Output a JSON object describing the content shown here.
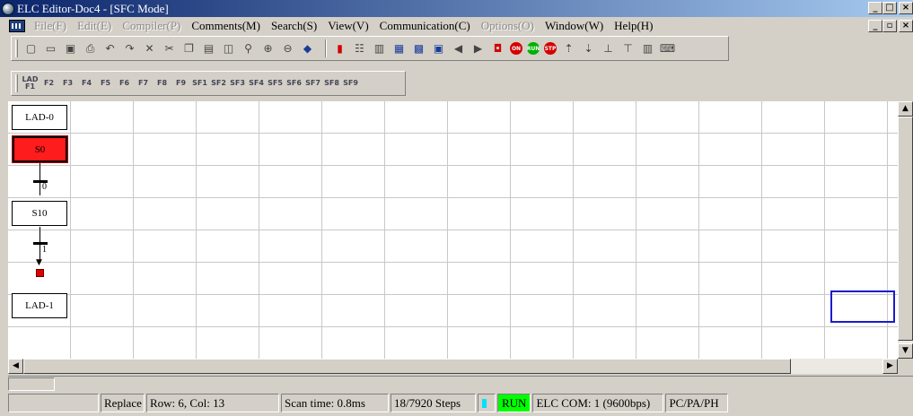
{
  "window": {
    "title": "ELC Editor-Doc4 - [SFC Mode]",
    "controls": {
      "minimize": "_",
      "restore": "□",
      "close": "×",
      "mdi_minimize": "_",
      "mdi_restore": "▫",
      "mdi_close": "×"
    }
  },
  "menu": [
    {
      "label": "File(F)",
      "enabled": false
    },
    {
      "label": "Edit(E)",
      "enabled": false
    },
    {
      "label": "Compiler(P)",
      "enabled": false
    },
    {
      "label": "Comments(M)",
      "enabled": true
    },
    {
      "label": "Search(S)",
      "enabled": true
    },
    {
      "label": "View(V)",
      "enabled": true
    },
    {
      "label": "Communication(C)",
      "enabled": true
    },
    {
      "label": "Options(O)",
      "enabled": false
    },
    {
      "label": "Window(W)",
      "enabled": true
    },
    {
      "label": "Help(H)",
      "enabled": true
    }
  ],
  "toolbar2": {
    "labels": [
      "LAD F1",
      "F2",
      "F3",
      "F4",
      "F5",
      "F6",
      "F7",
      "F8",
      "F9",
      "SF1",
      "SF2",
      "SF3",
      "SF4",
      "SF5",
      "SF6",
      "SF7",
      "SF8",
      "SF9"
    ]
  },
  "diagram": {
    "ladder_top": "LAD-0",
    "step_initial": "S0",
    "transition_0": "0",
    "step_10": "S10",
    "transition_1": "1",
    "ladder_bottom": "LAD-1",
    "colors": {
      "initial_step": "#ff1c1c",
      "jump_marker": "#e00000",
      "cursor": "#1b1bcc"
    }
  },
  "status": {
    "mode": "Replace",
    "position": "Row: 6, Col: 13",
    "scan_time": "Scan time: 0.8ms",
    "steps": "18/7920 Steps",
    "run": "RUN",
    "com": "ELC COM: 1  (9600bps)",
    "device": "PC/PA/PH"
  }
}
